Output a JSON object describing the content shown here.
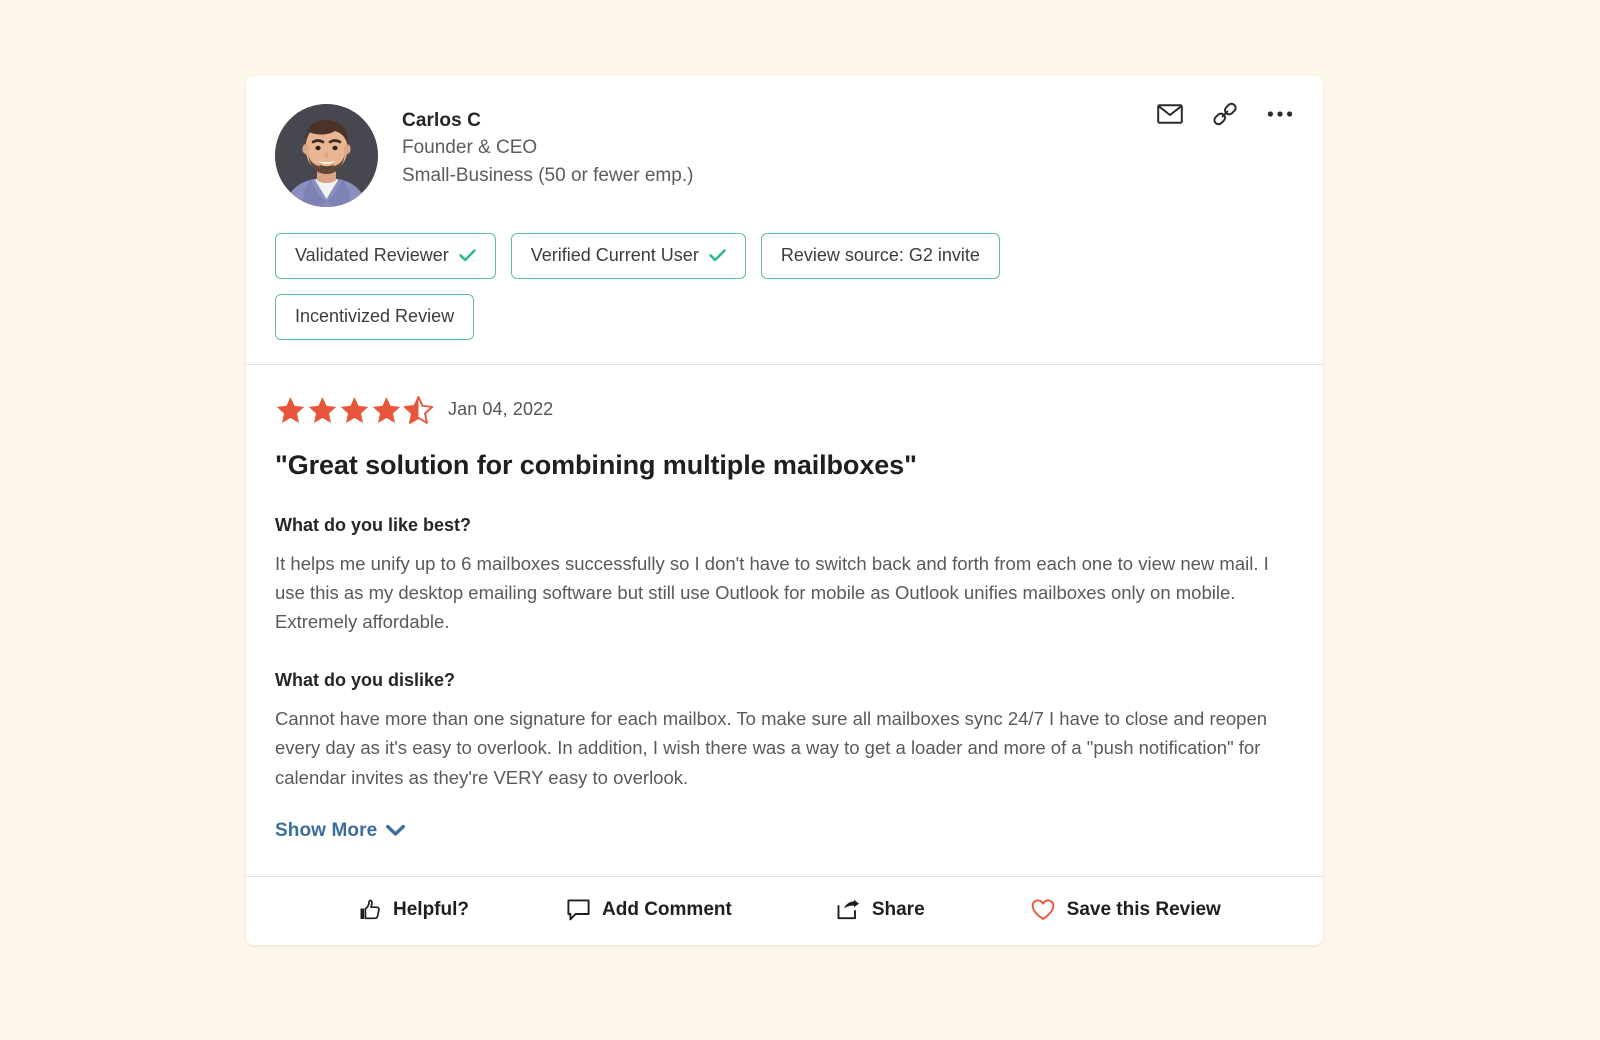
{
  "theme": {
    "page_background": "#FDF8E9",
    "card_background": "#FFFFFF",
    "badge_border": "#5DC39A",
    "check_green": "#34B98A",
    "star_orange": "#E8553A",
    "link_blue": "#3C6E9B",
    "heart_red": "#E8553A",
    "divider": "#E2E2E2"
  },
  "reviewer": {
    "name": "Carlos C",
    "role": "Founder & CEO",
    "company_size": "Small-Business (50 or fewer emp.)",
    "avatar_alt": "Carlos C profile photo"
  },
  "header_actions": [
    {
      "name": "email-icon",
      "label": "Email"
    },
    {
      "name": "link-icon",
      "label": "Copy link"
    },
    {
      "name": "more-icon",
      "label": "More options"
    }
  ],
  "badges": [
    {
      "label": "Validated Reviewer",
      "has_check": true
    },
    {
      "label": "Verified Current User",
      "has_check": true
    },
    {
      "label": "Review source: G2 invite",
      "has_check": false
    },
    {
      "label": "Incentivized Review",
      "has_check": false
    }
  ],
  "review": {
    "rating": 4.5,
    "max_rating": 5,
    "date": "Jan 04, 2022",
    "title": "\"Great solution for combining multiple mailboxes\"",
    "sections": [
      {
        "question": "What do you like best?",
        "answer": "It helps me unify up to 6 mailboxes successfully so I don't have to switch back and forth from each one to view new mail. I use this as my desktop emailing software but still use Outlook for mobile as Outlook unifies mailboxes only on mobile. Extremely affordable."
      },
      {
        "question": "What do you dislike?",
        "answer": "Cannot have more than one signature for each mailbox. To make sure all mailboxes sync 24/7 I have to close and reopen every day as it's easy to overlook. In addition, I wish there was a way to get a loader and more of a \"push notification\" for calendar invites as they're VERY easy to overlook."
      }
    ],
    "show_more_label": "Show More"
  },
  "footer_actions": [
    {
      "label": "Helpful?",
      "icon": "thumbs-up-icon"
    },
    {
      "label": "Add Comment",
      "icon": "comment-icon"
    },
    {
      "label": "Share",
      "icon": "share-icon"
    },
    {
      "label": "Save this Review",
      "icon": "heart-icon"
    }
  ]
}
